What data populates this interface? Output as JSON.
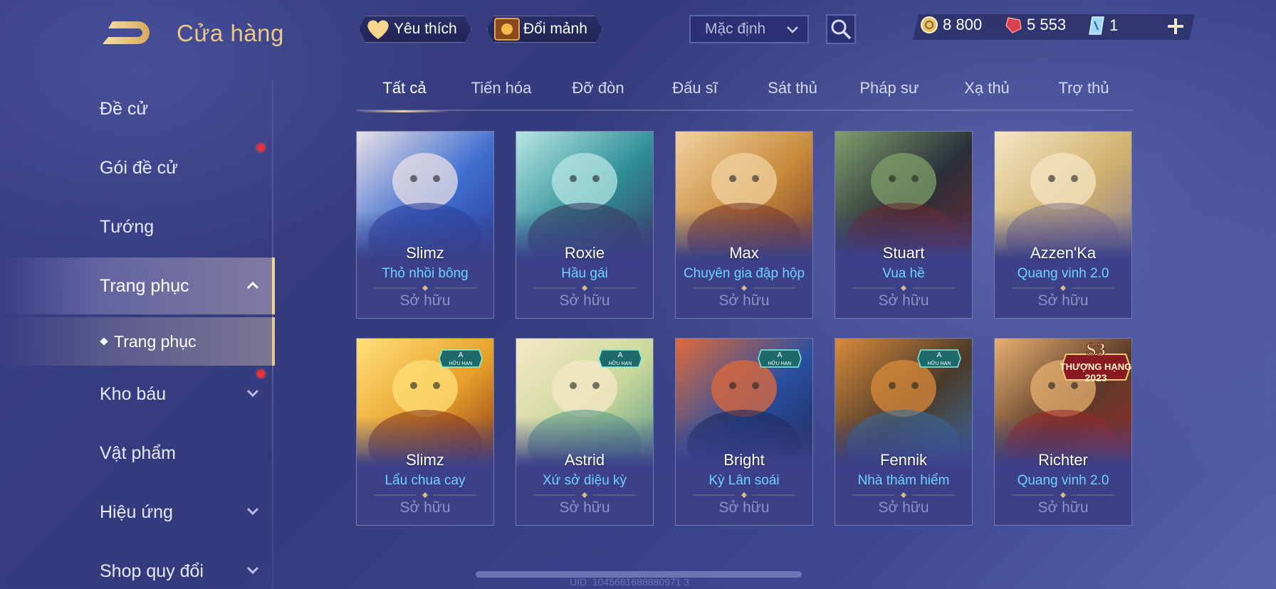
{
  "header": {
    "title": "Cửa hàng"
  },
  "sidebar": {
    "items": [
      {
        "label": "Đề cử"
      },
      {
        "label": "Gói đề cử"
      },
      {
        "label": "Tướng"
      },
      {
        "label": "Trang phục"
      },
      {
        "label": "Kho báu"
      },
      {
        "label": "Vật phẩm"
      },
      {
        "label": "Hiệu ứng"
      },
      {
        "label": "Shop quy đổi"
      }
    ],
    "sub_item": {
      "label": "Trang phục"
    }
  },
  "topbar": {
    "favorite_label": "Yêu thích",
    "exchange_label": "Đổi mảnh",
    "sort_value": "Mặc định",
    "currency": {
      "gold": "8 800",
      "vouchers": "5 553",
      "gems": "1"
    }
  },
  "tabs": [
    {
      "label": "Tất cả"
    },
    {
      "label": "Tiến hóa"
    },
    {
      "label": "Đỡ đòn"
    },
    {
      "label": "Đấu sĩ"
    },
    {
      "label": "Sát thủ"
    },
    {
      "label": "Pháp sư"
    },
    {
      "label": "Xạ thủ"
    },
    {
      "label": "Trợ thủ"
    }
  ],
  "cards": [
    {
      "hero": "Slimz",
      "skin": "Thỏ nhồi bông",
      "status": "Sở hữu"
    },
    {
      "hero": "Roxie",
      "skin": "Hầu gái",
      "status": "Sở hữu"
    },
    {
      "hero": "Max",
      "skin": "Chuyên gia đập hộp",
      "status": "Sở hữu"
    },
    {
      "hero": "Stuart",
      "skin": "Vua hề",
      "status": "Sở hữu"
    },
    {
      "hero": "Azzen'Ka",
      "skin": "Quang vinh 2.0",
      "status": "Sở hữu"
    },
    {
      "hero": "Slimz",
      "skin": "Lẩu chua cay",
      "status": "Sở hữu"
    },
    {
      "hero": "Astrid",
      "skin": "Xứ sở diệu kỳ",
      "status": "Sở hữu"
    },
    {
      "hero": "Bright",
      "skin": "Kỳ Lân soái",
      "status": "Sở hữu"
    },
    {
      "hero": "Fennik",
      "skin": "Nhà thám hiểm",
      "status": "Sở hữu"
    },
    {
      "hero": "Richter",
      "skin": "Quang vinh 2.0",
      "status": "Sở hữu"
    }
  ],
  "badges": {
    "limited_top": "A",
    "limited_bottom": "HỮU HẠN",
    "season_top": "S3",
    "season_mid": "THƯỢNG HẠNG",
    "season_bottom": "2023"
  },
  "footer": {
    "uid": "UID: 1045681688880971 3"
  },
  "colors": {
    "accent_gold": "#e9c98a",
    "skin_name": "#6fd2ff",
    "owned": "#8f93c2",
    "notification": "#e8323a"
  }
}
